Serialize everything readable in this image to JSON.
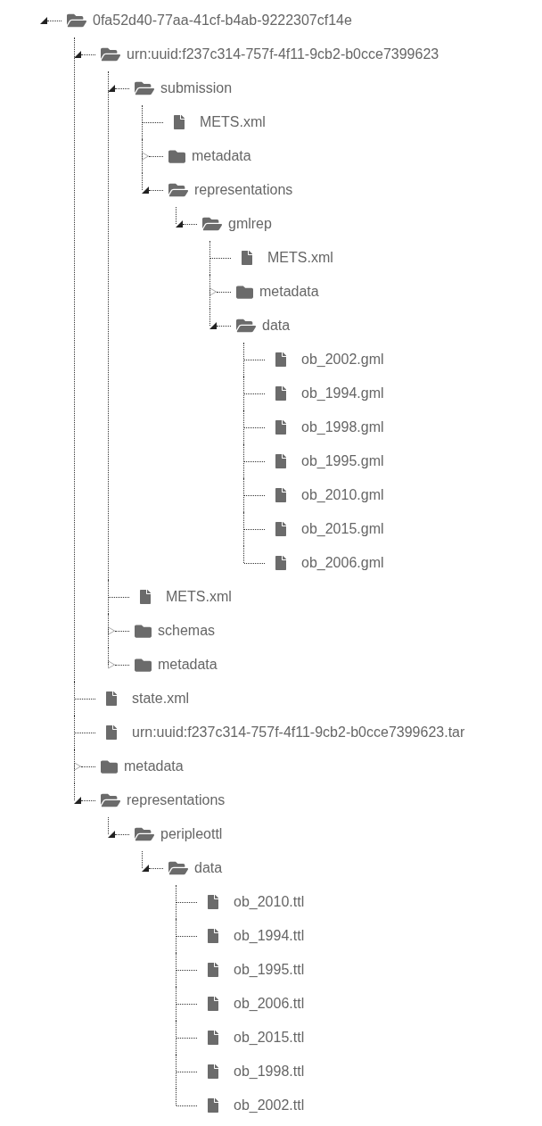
{
  "tree": [
    {
      "kind": "folder",
      "name": "0fa52d40-77aa-41cf-b4ab-9222307cf14e",
      "expanded": true,
      "children": [
        {
          "kind": "folder",
          "name": "urn:uuid:f237c314-757f-4f11-9cb2-b0cce7399623",
          "expanded": true,
          "children": [
            {
              "kind": "folder",
              "name": "submission",
              "expanded": true,
              "children": [
                {
                  "kind": "file",
                  "name": "METS.xml"
                },
                {
                  "kind": "folder",
                  "name": "metadata",
                  "expanded": false
                },
                {
                  "kind": "folder",
                  "name": "representations",
                  "expanded": true,
                  "children": [
                    {
                      "kind": "folder",
                      "name": "gmlrep",
                      "expanded": true,
                      "children": [
                        {
                          "kind": "file",
                          "name": "METS.xml"
                        },
                        {
                          "kind": "folder",
                          "name": "metadata",
                          "expanded": false
                        },
                        {
                          "kind": "folder",
                          "name": "data",
                          "expanded": true,
                          "children": [
                            {
                              "kind": "file",
                              "name": "ob_2002.gml"
                            },
                            {
                              "kind": "file",
                              "name": "ob_1994.gml"
                            },
                            {
                              "kind": "file",
                              "name": "ob_1998.gml"
                            },
                            {
                              "kind": "file",
                              "name": "ob_1995.gml"
                            },
                            {
                              "kind": "file",
                              "name": "ob_2010.gml"
                            },
                            {
                              "kind": "file",
                              "name": "ob_2015.gml"
                            },
                            {
                              "kind": "file",
                              "name": "ob_2006.gml"
                            }
                          ]
                        }
                      ]
                    }
                  ]
                }
              ]
            },
            {
              "kind": "file",
              "name": "METS.xml"
            },
            {
              "kind": "folder",
              "name": "schemas",
              "expanded": false
            },
            {
              "kind": "folder",
              "name": "metadata",
              "expanded": false
            }
          ]
        },
        {
          "kind": "file",
          "name": "state.xml"
        },
        {
          "kind": "file",
          "name": "urn:uuid:f237c314-757f-4f11-9cb2-b0cce7399623.tar"
        },
        {
          "kind": "folder",
          "name": "metadata",
          "expanded": false
        },
        {
          "kind": "folder",
          "name": "representations",
          "expanded": true,
          "children": [
            {
              "kind": "folder",
              "name": "peripleottl",
              "expanded": true,
              "children": [
                {
                  "kind": "folder",
                  "name": "data",
                  "expanded": true,
                  "children": [
                    {
                      "kind": "file",
                      "name": "ob_2010.ttl"
                    },
                    {
                      "kind": "file",
                      "name": "ob_1994.ttl"
                    },
                    {
                      "kind": "file",
                      "name": "ob_1995.ttl"
                    },
                    {
                      "kind": "file",
                      "name": "ob_2006.ttl"
                    },
                    {
                      "kind": "file",
                      "name": "ob_2015.ttl"
                    },
                    {
                      "kind": "file",
                      "name": "ob_1998.ttl"
                    },
                    {
                      "kind": "file",
                      "name": "ob_2002.ttl"
                    }
                  ]
                }
              ]
            }
          ]
        }
      ]
    }
  ]
}
